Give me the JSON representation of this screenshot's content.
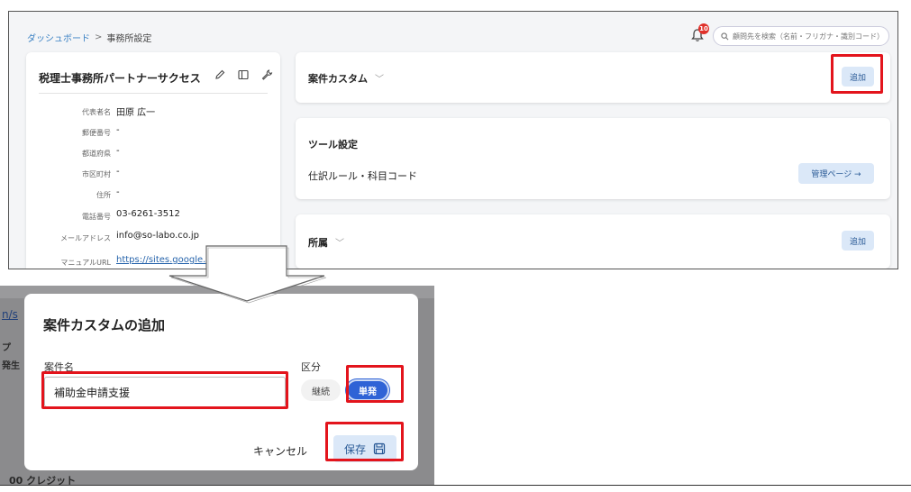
{
  "header": {
    "breadcrumb": [
      "ダッシュボード",
      "事務所設定"
    ],
    "breadcrumb_sep": ">",
    "notification_count": "10",
    "search_placeholder": "顧問先を検索（名前・フリガナ・識別コード）"
  },
  "profile": {
    "office_name": "税理士事務所パートナーサクセス",
    "fields": [
      {
        "label": "代表者名",
        "value": "田原 広一"
      },
      {
        "label": "郵便番号",
        "value": "-"
      },
      {
        "label": "都道府県",
        "value": "-"
      },
      {
        "label": "市区町村",
        "value": "-"
      },
      {
        "label": "住所",
        "value": "-"
      },
      {
        "label": "電話番号",
        "value": "03-6261-3512"
      },
      {
        "label": "メールアドレス",
        "value": "info@so-labo.co.jp"
      },
      {
        "label": "マニュアルURL",
        "value": "https://sites.google.com"
      }
    ]
  },
  "sections": {
    "case_custom": {
      "title": "案件カスタム",
      "add_label": "追加"
    },
    "tools": {
      "title": "ツール設定",
      "rule_label": "仕訳ルール・科目コード",
      "manage_label": "管理ページ →"
    },
    "affiliation": {
      "title": "所属",
      "add_label": "追加"
    }
  },
  "dialog": {
    "title": "案件カスタムの追加",
    "name_label": "案件名",
    "name_value": "補助金申請支援",
    "type_label": "区分",
    "type_options": [
      "継続",
      "単発"
    ],
    "type_selected": "単発",
    "cancel_label": "キャンセル",
    "save_label": "保存"
  },
  "background": {
    "left_text": [
      "n/s",
      "プ",
      "発生"
    ],
    "bottom_text": "00 クレジット"
  },
  "colors": {
    "highlight": "#e3141c",
    "accent": "#2f63d6",
    "button_bg": "#dbe8f8",
    "link": "#3b82c4"
  }
}
